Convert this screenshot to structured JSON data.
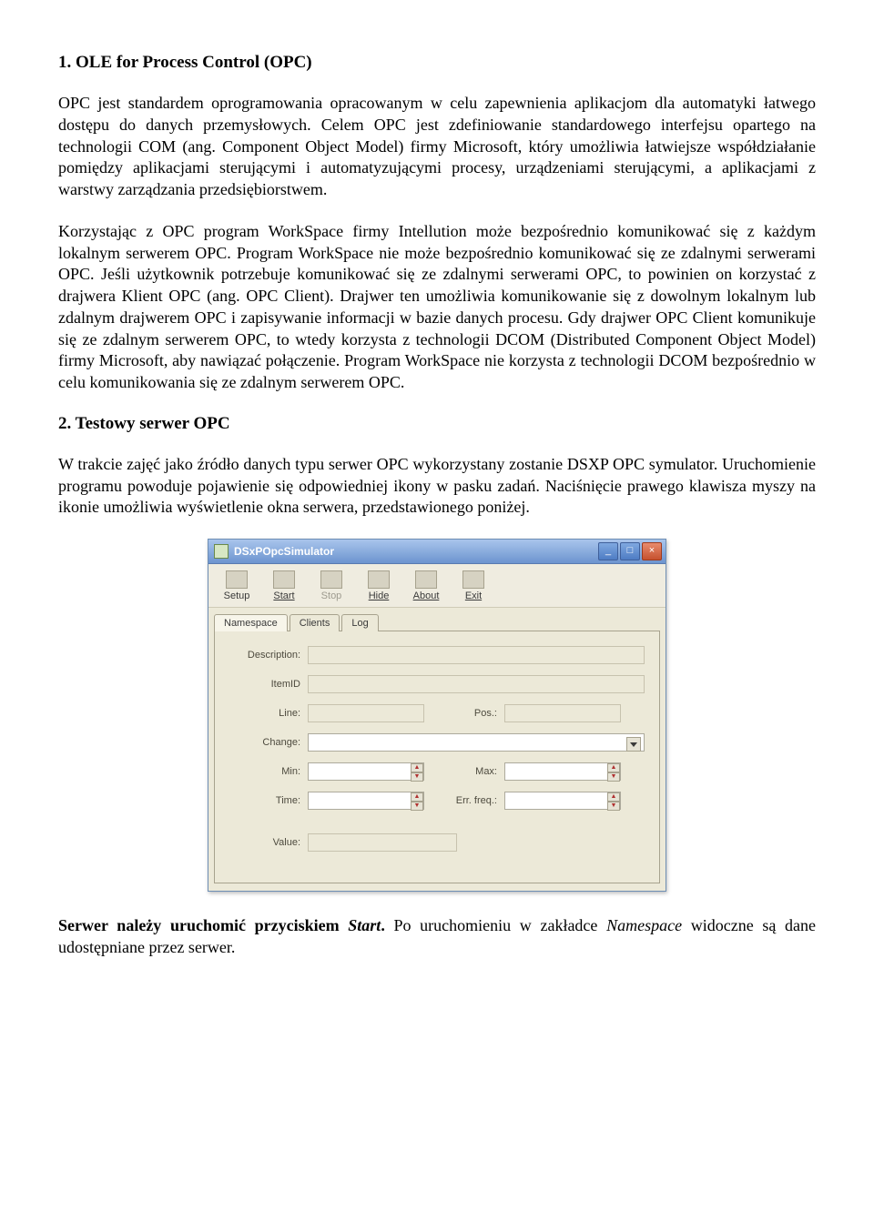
{
  "sections": {
    "s1": {
      "heading": "1. OLE for Process Control (OPC)",
      "p1": "OPC jest standardem oprogramowania opracowanym w celu zapewnienia aplikacjom dla automatyki łatwego dostępu do danych przemysłowych. Celem OPC jest zdefiniowanie standardowego interfejsu opartego na technologii COM (ang. Component Object Model) firmy Microsoft, który umożliwia łatwiejsze współdziałanie pomiędzy aplikacjami sterującymi i automatyzującymi procesy, urządzeniami sterującymi, a aplikacjami z warstwy zarządzania przedsiębiorstwem.",
      "p2": "Korzystając z OPC program WorkSpace firmy Intellution może bezpośrednio komunikować się z każdym lokalnym serwerem OPC. Program WorkSpace nie może bezpośrednio komunikować się ze zdalnymi serwerami OPC. Jeśli użytkownik potrzebuje komunikować się ze zdalnymi serwerami OPC, to powinien on korzystać z drajwera Klient OPC (ang. OPC Client). Drajwer ten umożliwia komunikowanie się z dowolnym lokalnym lub zdalnym drajwerem OPC i zapisywanie informacji w bazie danych procesu. Gdy drajwer OPC Client komunikuje się ze zdalnym serwerem OPC, to wtedy korzysta z technologii DCOM (Distributed Component Object Model) firmy Microsoft, aby nawiązać połączenie. Program WorkSpace nie korzysta z technologii DCOM bezpośrednio w celu komunikowania się ze zdalnym serwerem OPC."
    },
    "s2": {
      "heading": "2. Testowy serwer OPC",
      "p1": "W trakcie zajęć jako źródło danych typu serwer OPC wykorzystany zostanie DSXP OPC symulator. Uruchomienie programu powoduje pojawienie się odpowiedniej ikony w pasku zadań. Naciśnięcie prawego klawisza myszy na ikonie umożliwia wyświetlenie okna serwera, przedstawionego poniżej."
    },
    "footer": "Serwer należy uruchomić przyciskiem Start. Po uruchomieniu w zakładce Namespace widoczne są dane udostępniane przez serwer."
  },
  "window": {
    "title": "DSxPOpcSimulator",
    "toolbar": {
      "setup": "Setup",
      "start": "Start",
      "stop": "Stop",
      "hide": "Hide",
      "about": "About",
      "exit": "Exit"
    },
    "tabs": {
      "namespace": "Namespace",
      "clients": "Clients",
      "log": "Log"
    },
    "fields": {
      "description": "Description:",
      "itemid": "ItemID",
      "line": "Line:",
      "pos": "Pos.:",
      "change": "Change:",
      "min": "Min:",
      "max": "Max:",
      "time": "Time:",
      "errfreq": "Err. freq.:",
      "value": "Value:"
    }
  }
}
